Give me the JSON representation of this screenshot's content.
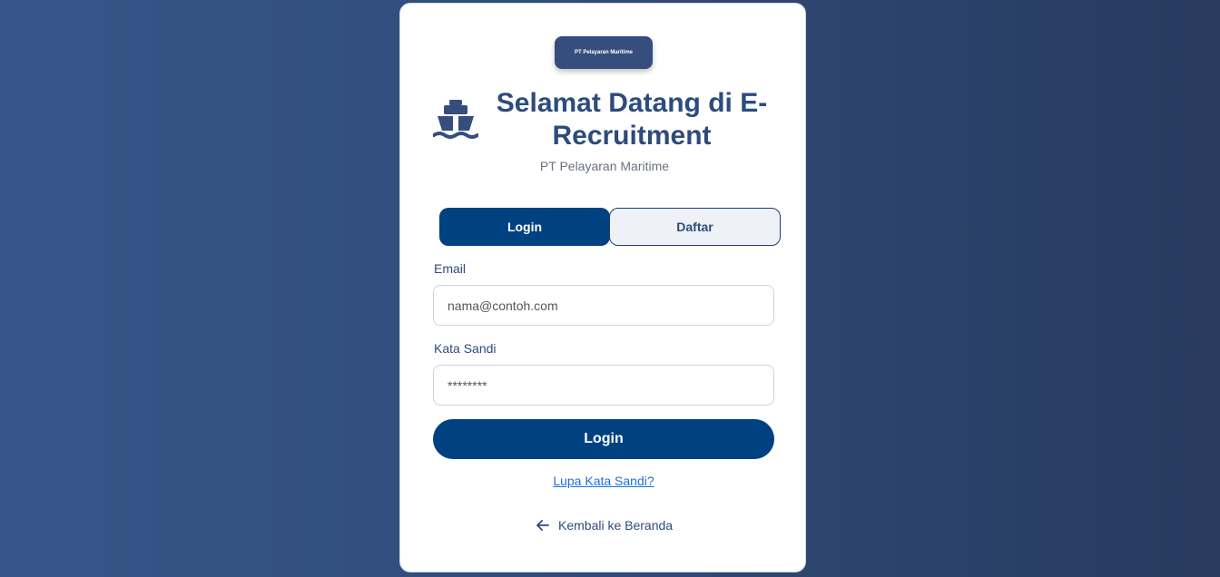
{
  "header": {
    "logo_text": "PT Pelayaran Maritime",
    "title": "Selamat Datang di E-Recruitment",
    "subtitle": "PT Pelayaran Maritime",
    "icon": "ship-icon"
  },
  "tabs": [
    {
      "label": "Login",
      "active": true
    },
    {
      "label": "Daftar",
      "active": false
    }
  ],
  "form": {
    "email_label": "Email",
    "email_placeholder": "nama@contoh.com",
    "email_value": "",
    "password_label": "Kata Sandi",
    "password_placeholder": "********",
    "password_value": "",
    "submit_label": "Login",
    "forgot_label": "Lupa Kata Sandi?"
  },
  "footer": {
    "back_label": "Kembali ke Beranda",
    "back_icon": "arrow-left-icon"
  },
  "colors": {
    "primary": "#004181",
    "heading": "#2d4b7c",
    "link": "#1d6fd8",
    "background_start": "#36568a",
    "background_end": "#283a5e"
  }
}
